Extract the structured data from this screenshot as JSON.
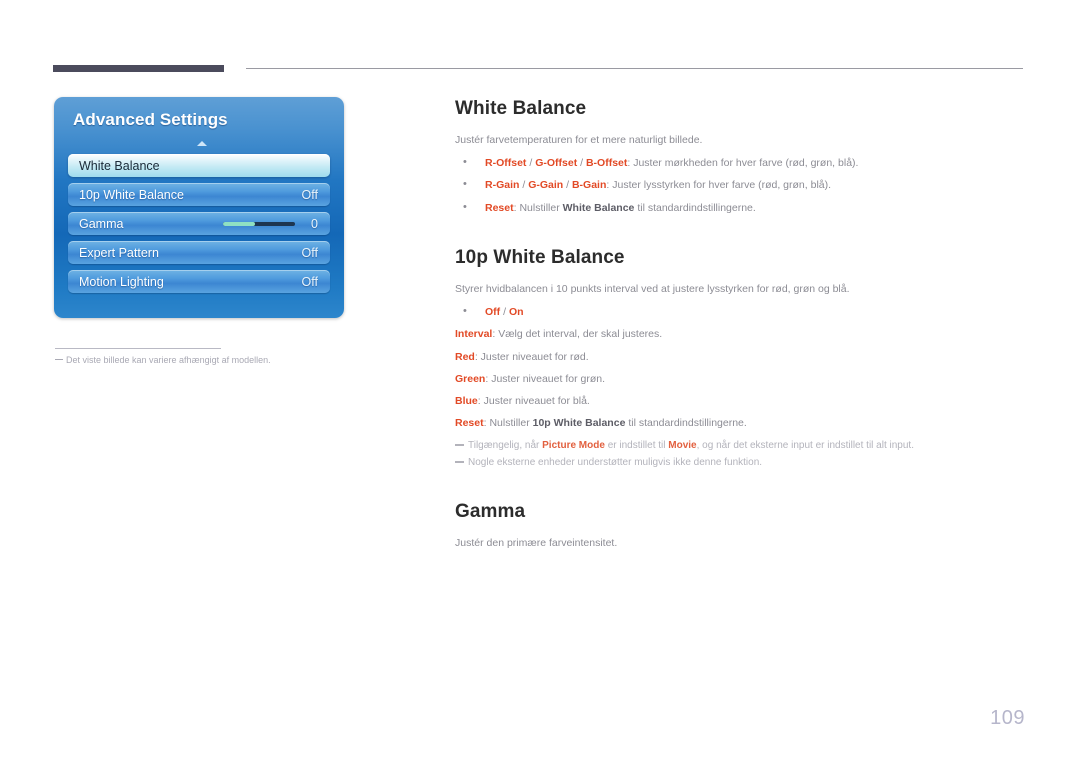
{
  "header": {
    "rule_thick_color": "#4b4b5c",
    "rule_thin_color": "#9a9aa2"
  },
  "osd": {
    "title": "Advanced Settings",
    "scroll_up_icon": "triangle-up-icon",
    "rows": [
      {
        "label": "White Balance",
        "value": "",
        "selected": true,
        "type": "item"
      },
      {
        "label": "10p White Balance",
        "value": "Off",
        "selected": false,
        "type": "item"
      },
      {
        "label": "Gamma",
        "value": "0",
        "selected": false,
        "type": "slider",
        "slider_fill_percent": 44
      },
      {
        "label": "Expert Pattern",
        "value": "Off",
        "selected": false,
        "type": "item"
      },
      {
        "label": "Motion Lighting",
        "value": "Off",
        "selected": false,
        "type": "item"
      }
    ],
    "note": "Det viste billede kan variere afhængigt af modellen."
  },
  "sections": {
    "white_balance": {
      "title": "White Balance",
      "desc": "Justér farvetemperaturen for et mere naturligt billede.",
      "bullets": [
        {
          "parts": [
            {
              "t": "R-Offset",
              "s": "kw"
            },
            {
              "t": " / ",
              "s": ""
            },
            {
              "t": "G-Offset",
              "s": "kw"
            },
            {
              "t": " / ",
              "s": ""
            },
            {
              "t": "B-Offset",
              "s": "kw"
            },
            {
              "t": ": Juster mørkheden for hver farve (rød, grøn, blå).",
              "s": ""
            }
          ]
        },
        {
          "parts": [
            {
              "t": "R-Gain",
              "s": "kw"
            },
            {
              "t": " / ",
              "s": ""
            },
            {
              "t": "G-Gain",
              "s": "kw"
            },
            {
              "t": " / ",
              "s": ""
            },
            {
              "t": "B-Gain",
              "s": "kw"
            },
            {
              "t": ": Juster lysstyrken for hver farve (rød, grøn, blå).",
              "s": ""
            }
          ]
        },
        {
          "parts": [
            {
              "t": "Reset",
              "s": "kw"
            },
            {
              "t": ": Nulstiller ",
              "s": ""
            },
            {
              "t": "White Balance",
              "s": "kw-dark"
            },
            {
              "t": " til standardindstillingerne.",
              "s": ""
            }
          ]
        }
      ]
    },
    "tenp_white_balance": {
      "title": "10p White Balance",
      "desc": "Styrer hvidbalancen i 10 punkts interval ved at justere lysstyrken for rød, grøn og blå.",
      "bullets": [
        {
          "parts": [
            {
              "t": "Off",
              "s": "kw"
            },
            {
              "t": " / ",
              "s": ""
            },
            {
              "t": "On",
              "s": "kw"
            }
          ]
        }
      ],
      "lines": [
        {
          "parts": [
            {
              "t": "Interval",
              "s": "kw"
            },
            {
              "t": ": Vælg det interval, der skal justeres.",
              "s": ""
            }
          ]
        },
        {
          "parts": [
            {
              "t": "Red",
              "s": "kw"
            },
            {
              "t": ": Juster niveauet for rød.",
              "s": ""
            }
          ]
        },
        {
          "parts": [
            {
              "t": "Green",
              "s": "kw"
            },
            {
              "t": ": Juster niveauet for grøn.",
              "s": ""
            }
          ]
        },
        {
          "parts": [
            {
              "t": "Blue",
              "s": "kw"
            },
            {
              "t": ": Juster niveauet for blå.",
              "s": ""
            }
          ]
        },
        {
          "parts": [
            {
              "t": "Reset",
              "s": "kw"
            },
            {
              "t": ": Nulstiller ",
              "s": ""
            },
            {
              "t": "10p White Balance",
              "s": "kw-dark"
            },
            {
              "t": " til standardindstillingerne.",
              "s": ""
            }
          ]
        }
      ],
      "notes": [
        {
          "parts": [
            {
              "t": "Tilgængelig, når ",
              "s": ""
            },
            {
              "t": "Picture Mode",
              "s": "nkw"
            },
            {
              "t": " er indstillet til ",
              "s": ""
            },
            {
              "t": "Movie",
              "s": "nkw"
            },
            {
              "t": ", og når det eksterne input er indstillet til alt input.",
              "s": ""
            }
          ]
        },
        {
          "parts": [
            {
              "t": "Nogle eksterne enheder understøtter muligvis ikke denne funktion.",
              "s": ""
            }
          ]
        }
      ]
    },
    "gamma": {
      "title": "Gamma",
      "desc": "Justér den primære farveintensitet."
    }
  },
  "page_number": "109",
  "colors": {
    "accent_orange": "#e24a26",
    "body_gray": "#8c8c94",
    "note_gray": "#b3b3bb",
    "title_dark": "#2c2c2c",
    "page_number": "#b6b6cb"
  }
}
